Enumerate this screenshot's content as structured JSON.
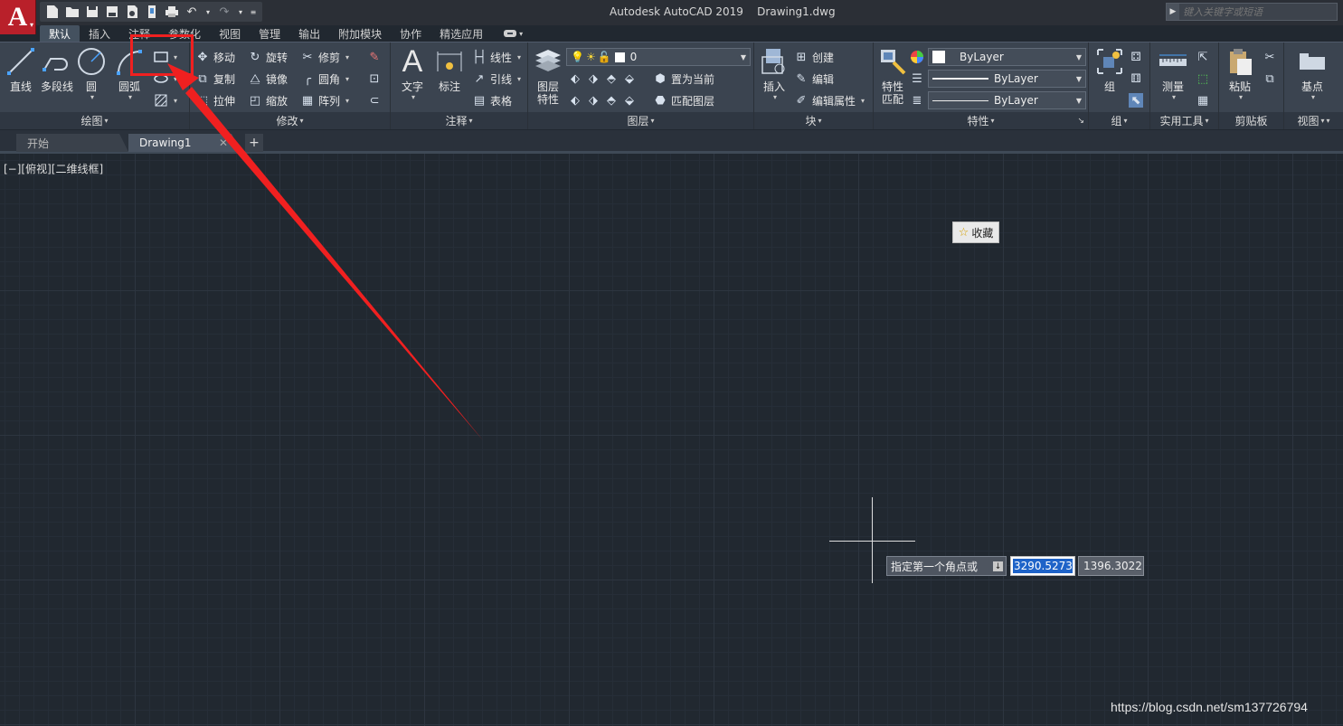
{
  "titlebar": {
    "app_logo": "A",
    "window_title": "Autodesk AutoCAD 2019    Drawing1.dwg",
    "search_placeholder": "键入关键字或短语",
    "qat_icons": [
      "new-icon",
      "open-icon",
      "save-icon",
      "save-as-icon",
      "publish-icon",
      "plot-icon",
      "print-icon",
      "undo-icon",
      "redo-icon",
      "customize-icon"
    ]
  },
  "ribbon_tabs": [
    "默认",
    "插入",
    "注释",
    "参数化",
    "视图",
    "管理",
    "输出",
    "附加模块",
    "协作",
    "精选应用"
  ],
  "active_tab": "默认",
  "panels": {
    "draw": {
      "title": "绘图",
      "line": "直线",
      "polyline": "多段线",
      "circle": "圆",
      "arc": "圆弧"
    },
    "modify": {
      "title": "修改",
      "move": "移动",
      "rotate": "旋转",
      "trim": "修剪",
      "copy": "复制",
      "mirror": "镜像",
      "fillet": "圆角",
      "stretch": "拉伸",
      "scale": "缩放",
      "array": "阵列"
    },
    "annotation": {
      "title": "注释",
      "text": "文字",
      "dimension": "标注",
      "linear": "线性",
      "leader": "引线",
      "table": "表格"
    },
    "layers": {
      "title": "图层",
      "layer_props": "图层\n特性",
      "layer_value": "0",
      "set_current": "置为当前",
      "match_layer": "匹配图层"
    },
    "block": {
      "title": "块",
      "insert": "插入",
      "create": "创建",
      "edit": "编辑",
      "edit_attr": "编辑属性"
    },
    "properties": {
      "title": "特性",
      "match": "特性\n匹配",
      "color": "ByLayer",
      "linetype": "ByLayer",
      "lineweight": "ByLayer"
    },
    "groups": {
      "title": "组",
      "group": "组"
    },
    "utilities": {
      "title": "实用工具",
      "measure": "测量"
    },
    "clipboard": {
      "title": "剪贴板",
      "paste": "粘贴"
    },
    "view": {
      "title": "视图",
      "base": "基点"
    }
  },
  "file_tabs": {
    "start": "开始",
    "drawing": "Drawing1",
    "add": "+"
  },
  "canvas": {
    "viewport_label": "[−][俯视][二维线框]",
    "favorite_button": "收藏",
    "prompt": "指定第一个角点或",
    "x_value": "3290.5273",
    "y_value": "1396.3022"
  },
  "watermark": "https://blog.csdn.net/sm137726794",
  "colors": {
    "canvas_bg": "#212830",
    "ribbon_bg": "#3b4450",
    "annotation_red": "#f02020",
    "logo_red": "#b9202a",
    "selection_blue": "#1e63c8"
  }
}
